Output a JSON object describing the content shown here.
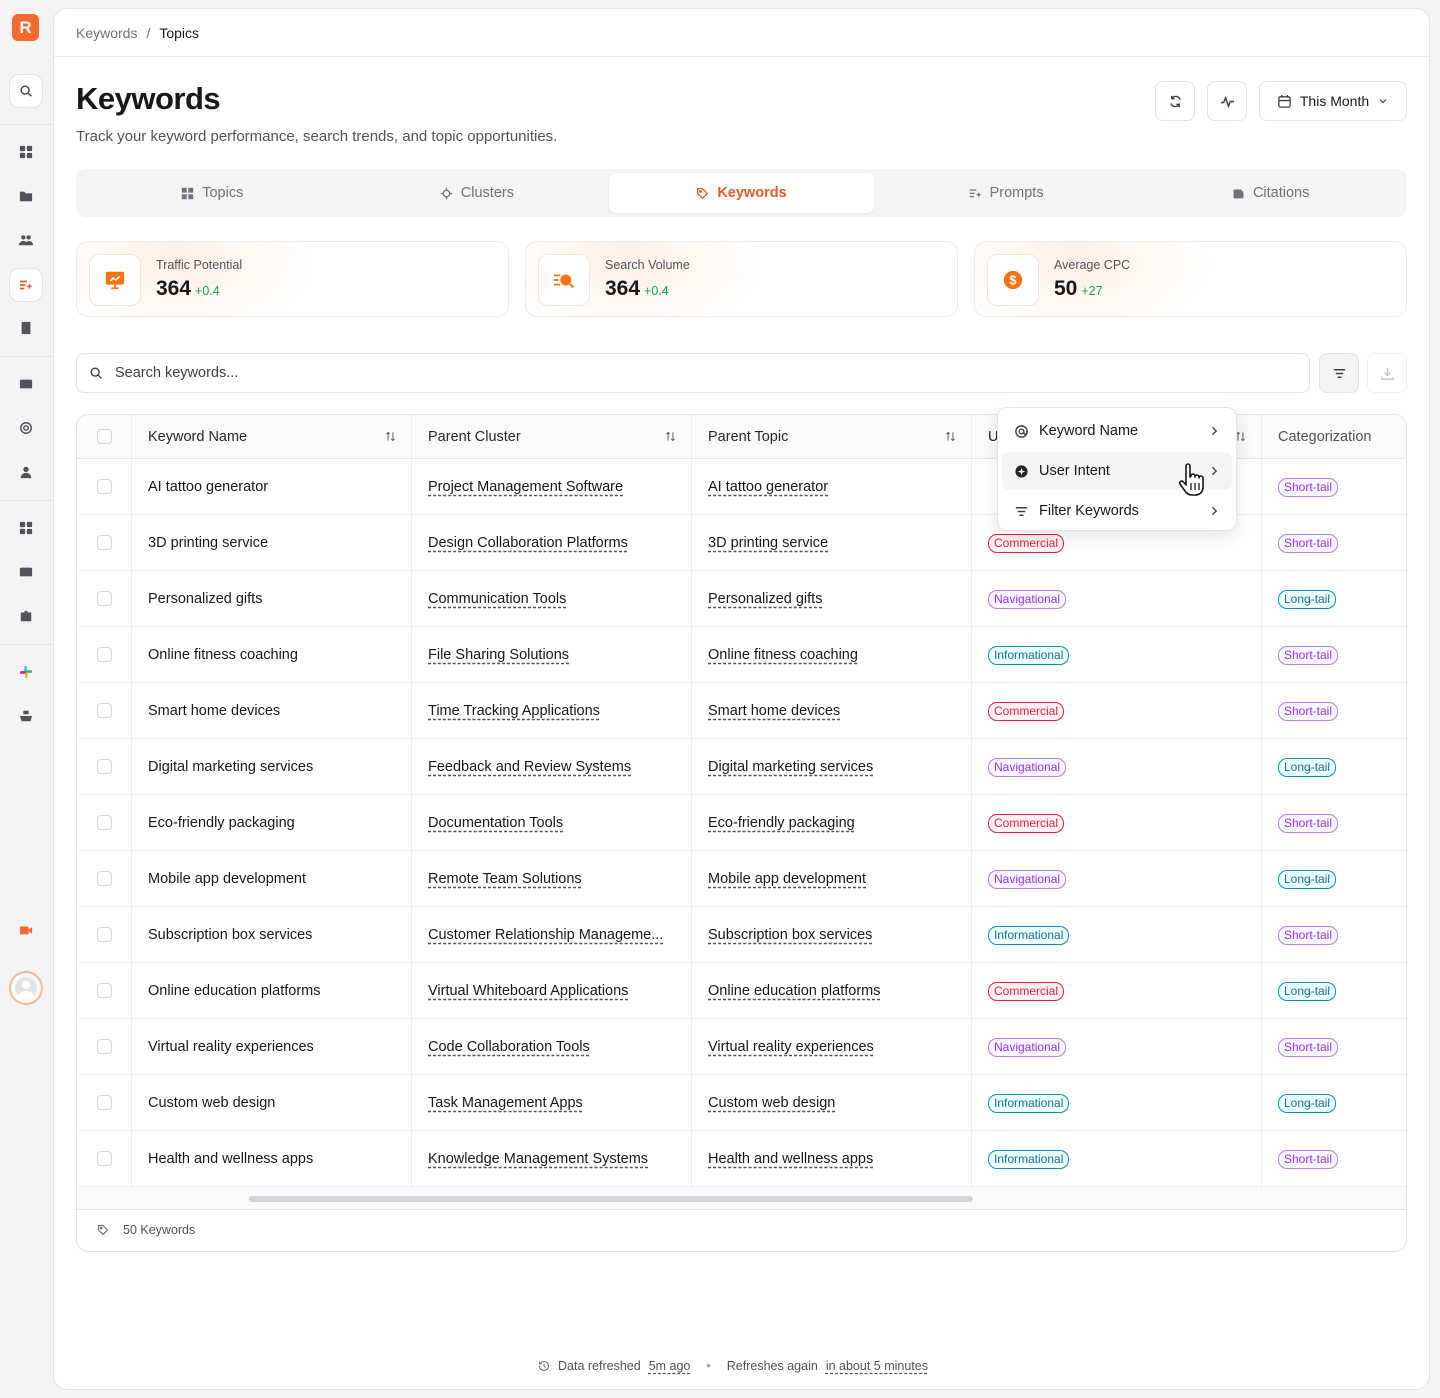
{
  "app": {
    "logo_letter": "R"
  },
  "breadcrumb": {
    "parent": "Keywords",
    "separator": "/",
    "current": "Topics"
  },
  "header": {
    "title": "Keywords",
    "subtitle": "Track your keyword performance, search trends, and topic opportunities.",
    "period_label": "This Month"
  },
  "tabs": [
    {
      "label": "Topics",
      "icon": "grid-icon",
      "active": false
    },
    {
      "label": "Clusters",
      "icon": "cluster-icon",
      "active": false
    },
    {
      "label": "Keywords",
      "icon": "tag-icon",
      "active": true
    },
    {
      "label": "Prompts",
      "icon": "prompts-icon",
      "active": false
    },
    {
      "label": "Citations",
      "icon": "citations-icon",
      "active": false
    }
  ],
  "stats": [
    {
      "label": "Traffic Potential",
      "value": "364",
      "delta": "+0.4",
      "icon": "presentation-icon"
    },
    {
      "label": "Search Volume",
      "value": "364",
      "delta": "+0.4",
      "icon": "search-list-icon"
    },
    {
      "label": "Average CPC",
      "value": "50",
      "delta": "+27",
      "icon": "dollar-icon"
    }
  ],
  "search": {
    "placeholder": "Search keywords..."
  },
  "table": {
    "columns": [
      "Keyword Name",
      "Parent Cluster",
      "Parent Topic",
      "U",
      "Categorization"
    ],
    "rows": [
      {
        "keyword": "AI tattoo generator",
        "cluster": "Project Management Software",
        "topic": "AI tattoo generator",
        "intent": "",
        "category": "Short-tail"
      },
      {
        "keyword": "3D printing service",
        "cluster": "Design Collaboration Platforms",
        "topic": "3D printing service",
        "intent": "Commercial",
        "category": "Short-tail"
      },
      {
        "keyword": "Personalized gifts",
        "cluster": "Communication Tools",
        "topic": "Personalized gifts",
        "intent": "Navigational",
        "category": "Long-tail"
      },
      {
        "keyword": "Online fitness coaching",
        "cluster": "File Sharing Solutions",
        "topic": "Online fitness coaching",
        "intent": "Informational",
        "category": "Short-tail"
      },
      {
        "keyword": "Smart home devices",
        "cluster": "Time Tracking Applications",
        "topic": "Smart home devices",
        "intent": "Commercial",
        "category": "Short-tail"
      },
      {
        "keyword": "Digital marketing services",
        "cluster": "Feedback and Review Systems",
        "topic": "Digital marketing services",
        "intent": "Navigational",
        "category": "Long-tail"
      },
      {
        "keyword": "Eco-friendly packaging",
        "cluster": "Documentation Tools",
        "topic": "Eco-friendly packaging",
        "intent": "Commercial",
        "category": "Short-tail"
      },
      {
        "keyword": "Mobile app development",
        "cluster": "Remote Team Solutions",
        "topic": "Mobile app development",
        "intent": "Navigational",
        "category": "Long-tail"
      },
      {
        "keyword": "Subscription box services",
        "cluster": "Customer Relationship Manageme...",
        "topic": "Subscription box services",
        "intent": "Informational",
        "category": "Short-tail"
      },
      {
        "keyword": "Online education platforms",
        "cluster": "Virtual Whiteboard Applications",
        "topic": "Online education platforms",
        "intent": "Commercial",
        "category": "Long-tail"
      },
      {
        "keyword": "Virtual reality experiences",
        "cluster": "Code Collaboration Tools",
        "topic": "Virtual reality experiences",
        "intent": "Navigational",
        "category": "Short-tail"
      },
      {
        "keyword": "Custom web design",
        "cluster": "Task Management Apps",
        "topic": "Custom web design",
        "intent": "Informational",
        "category": "Long-tail"
      },
      {
        "keyword": "Health and wellness apps",
        "cluster": "Knowledge Management Systems",
        "topic": "Health and wellness apps",
        "intent": "Informational",
        "category": "Short-tail"
      }
    ],
    "footer": "50 Keywords"
  },
  "dropdown": {
    "items": [
      {
        "label": "Keyword Name",
        "icon": "at-icon"
      },
      {
        "label": "User Intent",
        "icon": "target-icon"
      },
      {
        "label": "Filter Keywords",
        "icon": "filter-icon"
      }
    ]
  },
  "status_bar": {
    "refreshed_label": "Data refreshed",
    "refreshed_value": "5m ago",
    "separator": "•",
    "next_label": "Refreshes again",
    "next_value": "in about 5 minutes"
  },
  "colors": {
    "accent": "#e8592a",
    "commercial": "#e11d48",
    "navigational": "#9333ea",
    "informational": "#0891b2",
    "positive": "#16a34a"
  }
}
